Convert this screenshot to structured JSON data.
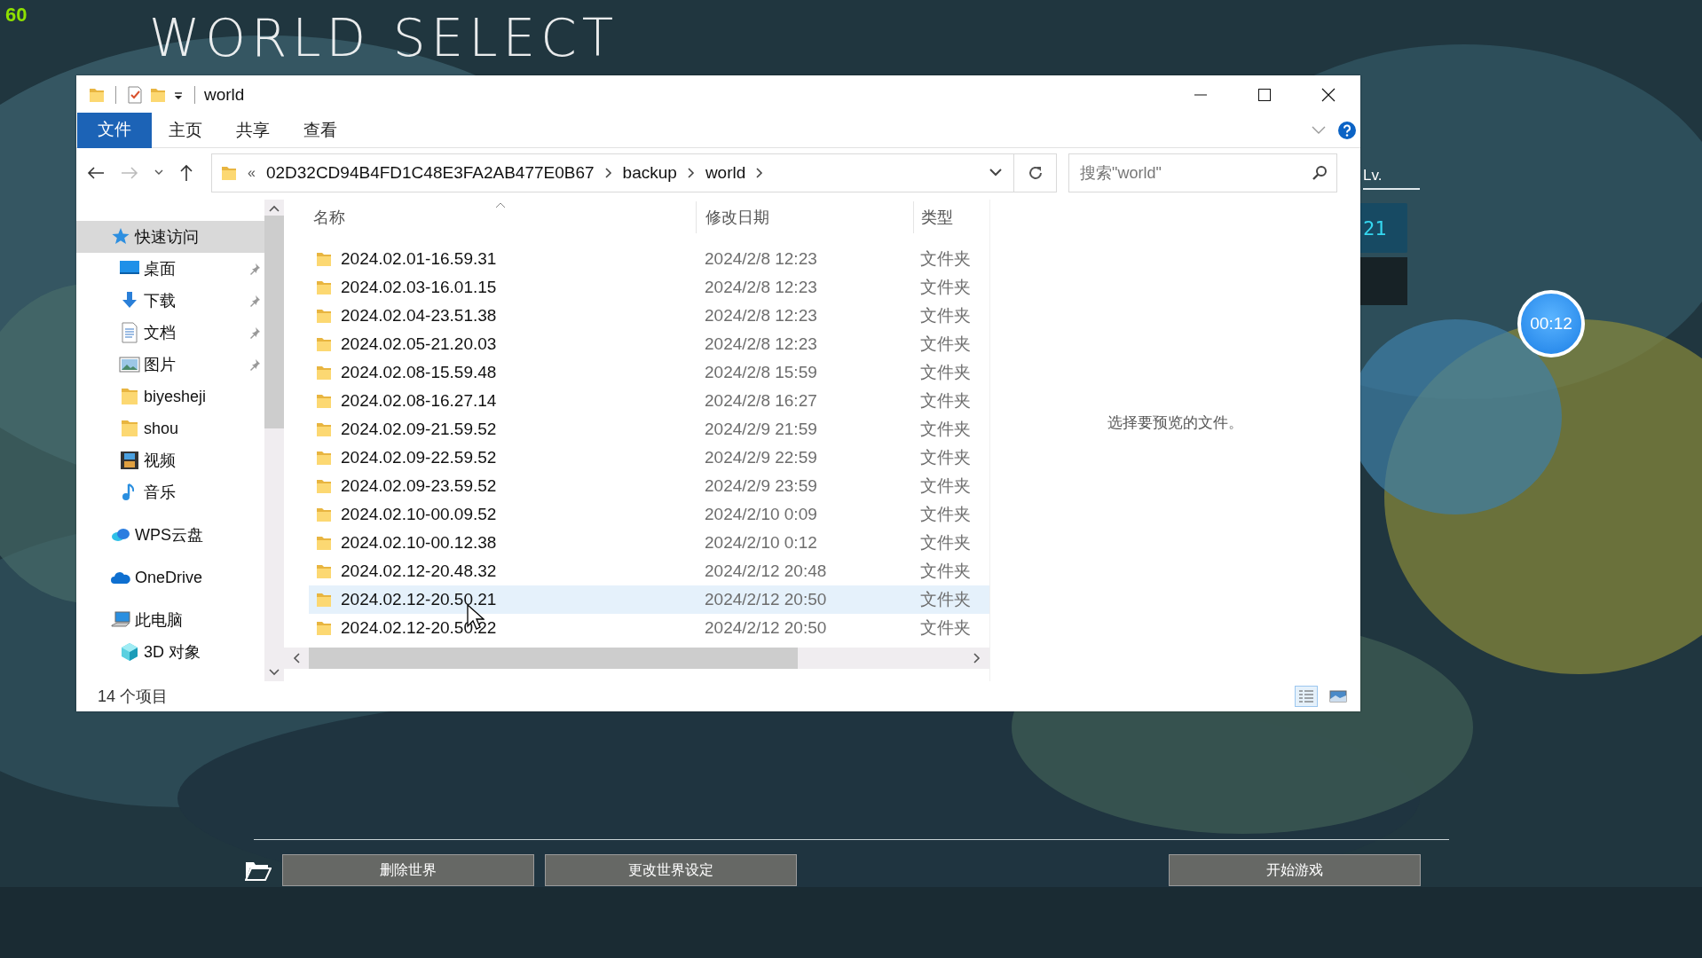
{
  "fps": "60",
  "screen_title": "WORLD SELECT",
  "explorer": {
    "title": "world",
    "ribbon_tabs": [
      {
        "label": "文件",
        "kind": "file",
        "selected": true
      },
      {
        "label": "主页",
        "kind": "tab",
        "selected": false
      },
      {
        "label": "共享",
        "kind": "tab",
        "selected": false
      },
      {
        "label": "查看",
        "kind": "tab",
        "selected": false
      }
    ],
    "address": {
      "overflow": "«",
      "segments": [
        "02D32CD94B4FD1C48E3FA2AB477E0B67",
        "backup",
        "world"
      ]
    },
    "search": {
      "placeholder": "搜索\"world\""
    },
    "nav_tree": [
      {
        "label": "快速访问",
        "kind": "star",
        "selected": true,
        "children": [
          {
            "label": "桌面",
            "kind": "desktop",
            "pinned": true
          },
          {
            "label": "下载",
            "kind": "download",
            "pinned": true
          },
          {
            "label": "文档",
            "kind": "document",
            "pinned": true
          },
          {
            "label": "图片",
            "kind": "pictures",
            "pinned": true
          },
          {
            "label": "biyesheji",
            "kind": "folder",
            "pinned": false
          },
          {
            "label": "shou",
            "kind": "folder",
            "pinned": false
          },
          {
            "label": "视频",
            "kind": "video",
            "pinned": false
          },
          {
            "label": "音乐",
            "kind": "music",
            "pinned": false
          }
        ]
      },
      {
        "label": "WPS云盘",
        "kind": "wps",
        "selected": false
      },
      {
        "label": "OneDrive",
        "kind": "cloud",
        "selected": false
      },
      {
        "label": "此电脑",
        "kind": "pc",
        "selected": false,
        "children": [
          {
            "label": "3D 对象",
            "kind": "cube",
            "pinned": false
          }
        ]
      }
    ],
    "columns": [
      {
        "label": "名称",
        "sorted": true
      },
      {
        "label": "修改日期",
        "sorted": false
      },
      {
        "label": "类型",
        "sorted": false
      }
    ],
    "rows": [
      {
        "name": "2024.02.01-16.59.31",
        "modified": "2024/2/8 12:23",
        "type": "文件夹",
        "selected": false
      },
      {
        "name": "2024.02.03-16.01.15",
        "modified": "2024/2/8 12:23",
        "type": "文件夹",
        "selected": false
      },
      {
        "name": "2024.02.04-23.51.38",
        "modified": "2024/2/8 12:23",
        "type": "文件夹",
        "selected": false
      },
      {
        "name": "2024.02.05-21.20.03",
        "modified": "2024/2/8 12:23",
        "type": "文件夹",
        "selected": false
      },
      {
        "name": "2024.02.08-15.59.48",
        "modified": "2024/2/8 15:59",
        "type": "文件夹",
        "selected": false
      },
      {
        "name": "2024.02.08-16.27.14",
        "modified": "2024/2/8 16:27",
        "type": "文件夹",
        "selected": false
      },
      {
        "name": "2024.02.09-21.59.52",
        "modified": "2024/2/9 21:59",
        "type": "文件夹",
        "selected": false
      },
      {
        "name": "2024.02.09-22.59.52",
        "modified": "2024/2/9 22:59",
        "type": "文件夹",
        "selected": false
      },
      {
        "name": "2024.02.09-23.59.52",
        "modified": "2024/2/9 23:59",
        "type": "文件夹",
        "selected": false
      },
      {
        "name": "2024.02.10-00.09.52",
        "modified": "2024/2/10 0:09",
        "type": "文件夹",
        "selected": false
      },
      {
        "name": "2024.02.10-00.12.38",
        "modified": "2024/2/10 0:12",
        "type": "文件夹",
        "selected": false
      },
      {
        "name": "2024.02.12-20.48.32",
        "modified": "2024/2/12 20:48",
        "type": "文件夹",
        "selected": false
      },
      {
        "name": "2024.02.12-20.50.21",
        "modified": "2024/2/12 20:50",
        "type": "文件夹",
        "selected": true
      },
      {
        "name": "2024.02.12-20.50.22",
        "modified": "2024/2/12 20:50",
        "type": "文件夹",
        "selected": false
      }
    ],
    "preview_message": "选择要预览的文件。",
    "status": "14 个项目",
    "view_buttons": [
      {
        "kind": "details",
        "selected": true
      },
      {
        "kind": "tiles",
        "selected": false
      }
    ]
  },
  "game": {
    "level_label": "Lv.",
    "level_value": "21",
    "timer": "00:12",
    "buttons": [
      {
        "label": "删除世界"
      },
      {
        "label": "更改世界设定"
      },
      {
        "label": "开始游戏"
      }
    ]
  }
}
